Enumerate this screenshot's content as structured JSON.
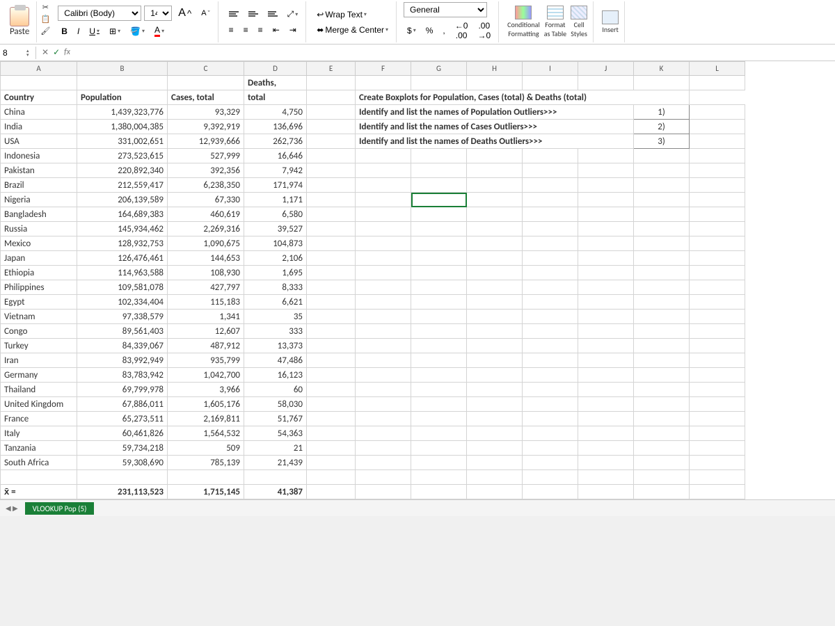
{
  "ribbon": {
    "paste": "Paste",
    "font_name": "Calibri (Body)",
    "font_size": "14",
    "bold": "B",
    "italic": "I",
    "underline": "U",
    "wrap": "Wrap Text",
    "merge": "Merge & Center",
    "number_format": "General",
    "currency": "$",
    "percent": "%",
    "comma": ",",
    "inc_dec": "←0 .00",
    "dec_dec": ".00 →0",
    "cond_fmt_l1": "Conditional",
    "cond_fmt_l2": "Formatting",
    "fmt_table_l1": "Format",
    "fmt_table_l2": "as Table",
    "cell_styles_l1": "Cell",
    "cell_styles_l2": "Styles",
    "insert": "Insert"
  },
  "formula_bar": {
    "name_box": "8",
    "cancel": "✕",
    "enter": "✓",
    "fx": "fx",
    "formula": ""
  },
  "columns": [
    "A",
    "B",
    "C",
    "D",
    "E",
    "F",
    "G",
    "H",
    "I",
    "J",
    "K",
    "L"
  ],
  "headers": {
    "country": "Country",
    "population": "Population",
    "cases": "Cases, total",
    "deaths_l1": "Deaths,",
    "deaths_l2": "total"
  },
  "instructions": {
    "line1": "Create Boxplots for Population, Cases (total) & Deaths (total)",
    "line2": "Identify and list the names of Population Outliers>>>",
    "line3": "Identify and list the names of Cases Outliers>>>",
    "line4": "Identify and list the names of Deaths Outliers>>>",
    "ans1": "1)",
    "ans2": "2)",
    "ans3": "3)"
  },
  "rows": [
    {
      "country": "China",
      "population": "1,439,323,776",
      "cases": "93,329",
      "deaths": "4,750"
    },
    {
      "country": "India",
      "population": "1,380,004,385",
      "cases": "9,392,919",
      "deaths": "136,696"
    },
    {
      "country": "USA",
      "population": "331,002,651",
      "cases": "12,939,666",
      "deaths": "262,736"
    },
    {
      "country": "Indonesia",
      "population": "273,523,615",
      "cases": "527,999",
      "deaths": "16,646"
    },
    {
      "country": "Pakistan",
      "population": "220,892,340",
      "cases": "392,356",
      "deaths": "7,942"
    },
    {
      "country": "Brazil",
      "population": "212,559,417",
      "cases": "6,238,350",
      "deaths": "171,974"
    },
    {
      "country": "Nigeria",
      "population": "206,139,589",
      "cases": "67,330",
      "deaths": "1,171"
    },
    {
      "country": "Bangladesh",
      "population": "164,689,383",
      "cases": "460,619",
      "deaths": "6,580"
    },
    {
      "country": "Russia",
      "population": "145,934,462",
      "cases": "2,269,316",
      "deaths": "39,527"
    },
    {
      "country": "Mexico",
      "population": "128,932,753",
      "cases": "1,090,675",
      "deaths": "104,873"
    },
    {
      "country": "Japan",
      "population": "126,476,461",
      "cases": "144,653",
      "deaths": "2,106"
    },
    {
      "country": "Ethiopia",
      "population": "114,963,588",
      "cases": "108,930",
      "deaths": "1,695"
    },
    {
      "country": "Philippines",
      "population": "109,581,078",
      "cases": "427,797",
      "deaths": "8,333"
    },
    {
      "country": "Egypt",
      "population": "102,334,404",
      "cases": "115,183",
      "deaths": "6,621"
    },
    {
      "country": "Vietnam",
      "population": "97,338,579",
      "cases": "1,341",
      "deaths": "35"
    },
    {
      "country": "Congo",
      "population": "89,561,403",
      "cases": "12,607",
      "deaths": "333"
    },
    {
      "country": "Turkey",
      "population": "84,339,067",
      "cases": "487,912",
      "deaths": "13,373"
    },
    {
      "country": "Iran",
      "population": "83,992,949",
      "cases": "935,799",
      "deaths": "47,486"
    },
    {
      "country": "Germany",
      "population": "83,783,942",
      "cases": "1,042,700",
      "deaths": "16,123"
    },
    {
      "country": "Thailand",
      "population": "69,799,978",
      "cases": "3,966",
      "deaths": "60"
    },
    {
      "country": "United Kingdom",
      "population": "67,886,011",
      "cases": "1,605,176",
      "deaths": "58,030"
    },
    {
      "country": "France",
      "population": "65,273,511",
      "cases": "2,169,811",
      "deaths": "51,767"
    },
    {
      "country": "Italy",
      "population": "60,461,826",
      "cases": "1,564,532",
      "deaths": "54,363"
    },
    {
      "country": "Tanzania",
      "population": "59,734,218",
      "cases": "509",
      "deaths": "21"
    },
    {
      "country": "South Africa",
      "population": "59,308,690",
      "cases": "785,139",
      "deaths": "21,439"
    }
  ],
  "summary": {
    "label": "x̄ =",
    "population": "231,113,523",
    "cases": "1,715,145",
    "deaths": "41,387"
  },
  "tabs": {
    "active": "VLOOKUP Pop (5)"
  }
}
